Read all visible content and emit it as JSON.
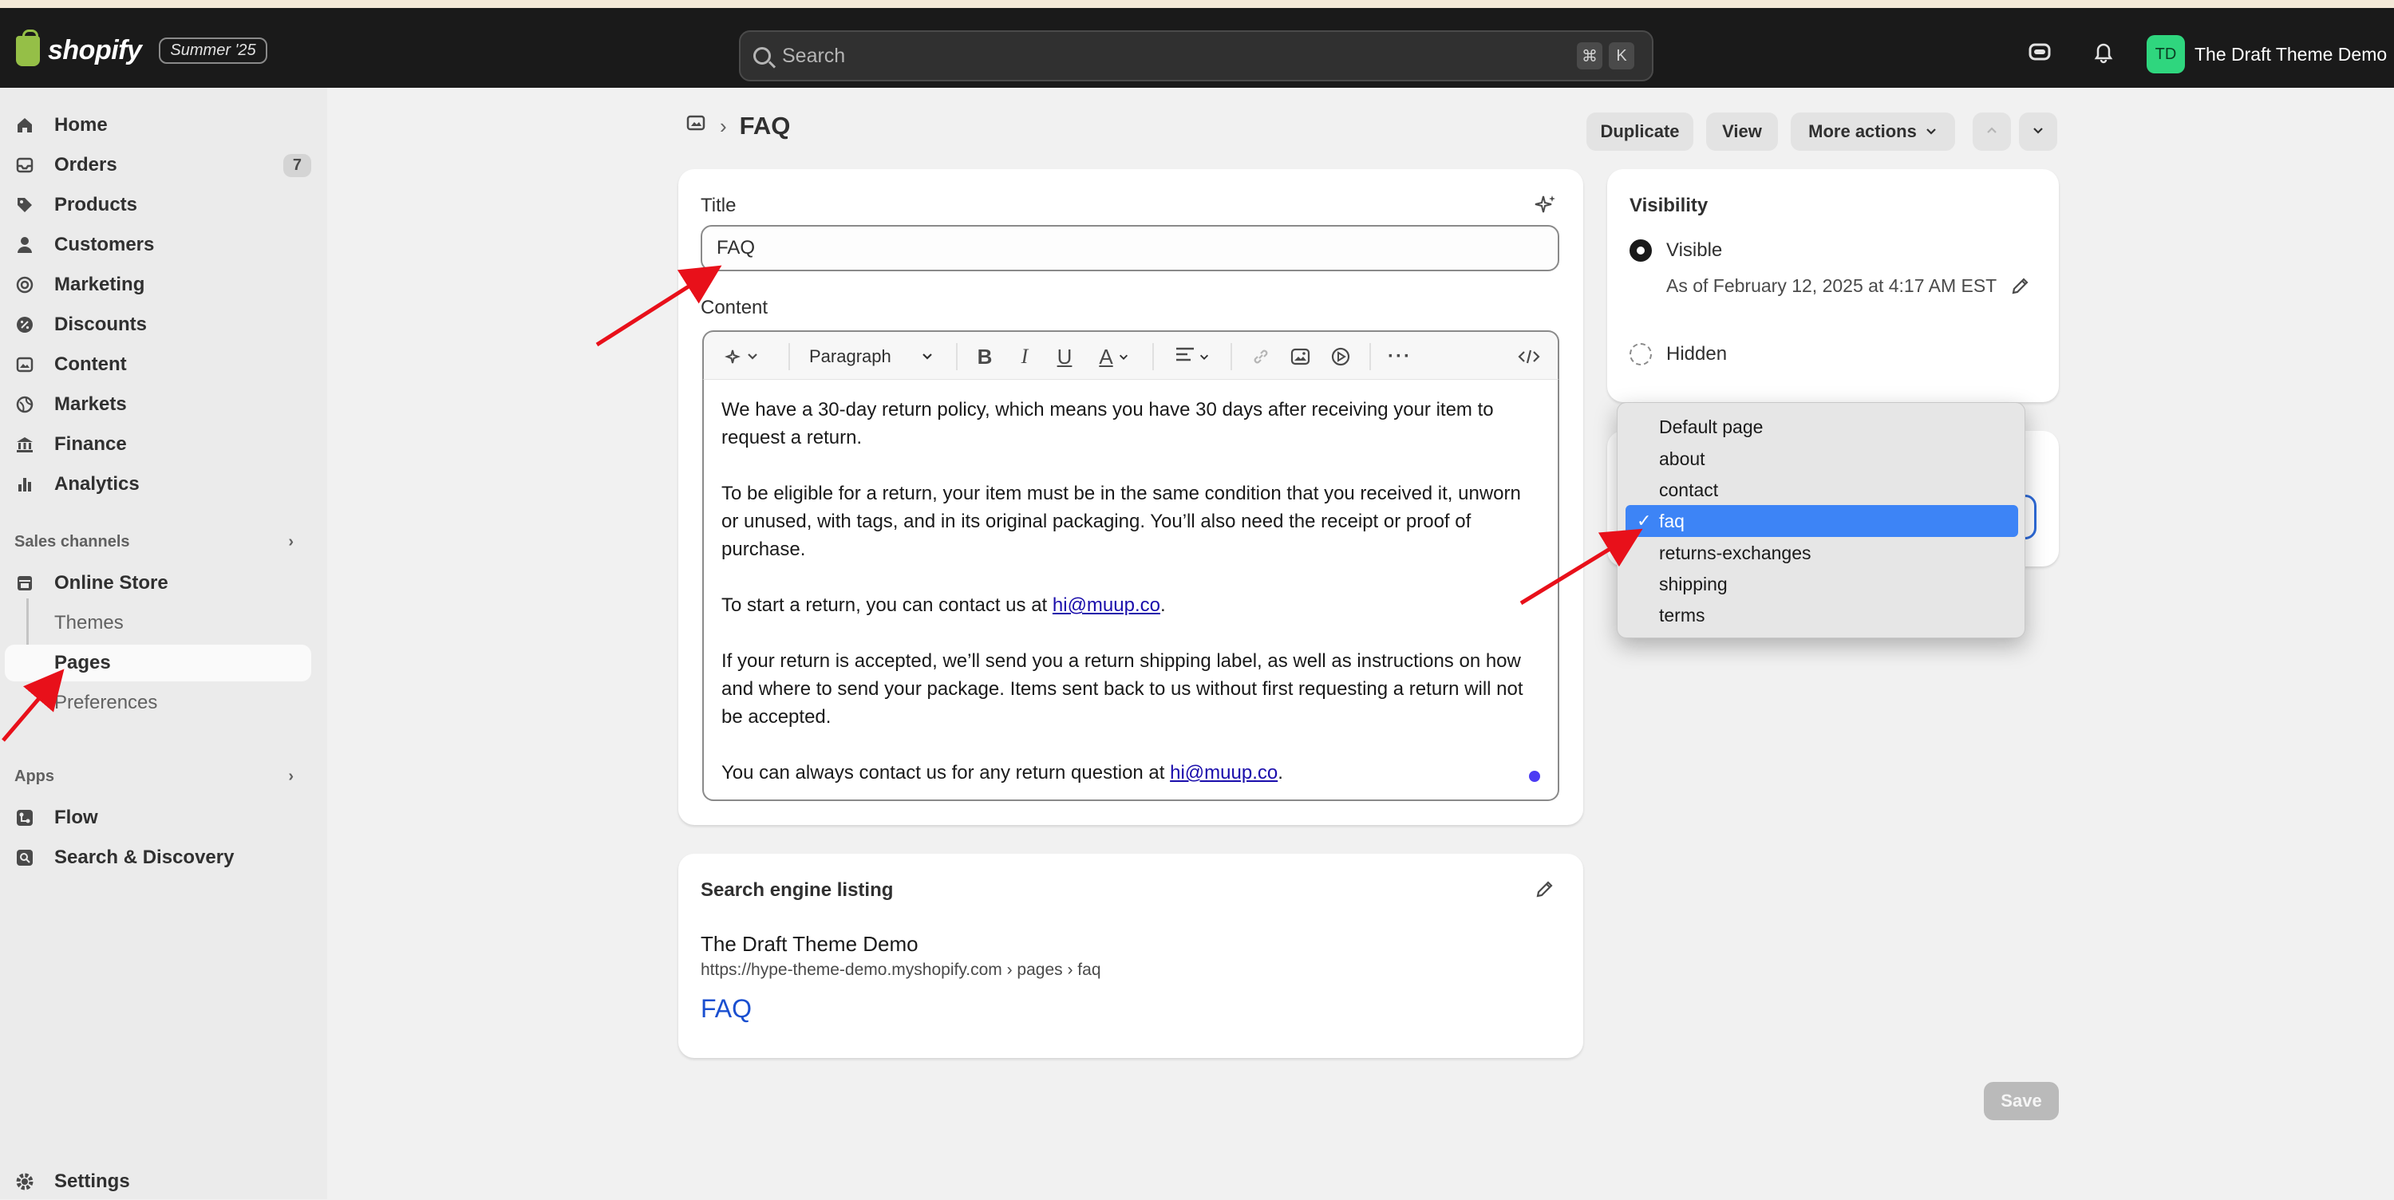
{
  "topbar": {
    "brand": "shopify",
    "edition": "Summer '25",
    "search_placeholder": "Search",
    "shortcut_keys": [
      "⌘",
      "K"
    ],
    "store_initials": "TD",
    "store_name": "The Draft Theme Demo"
  },
  "sidebar": {
    "items": [
      {
        "label": "Home",
        "icon": "home-icon"
      },
      {
        "label": "Orders",
        "icon": "inbox-icon",
        "badge": "7"
      },
      {
        "label": "Products",
        "icon": "tag-icon"
      },
      {
        "label": "Customers",
        "icon": "person-icon"
      },
      {
        "label": "Marketing",
        "icon": "target-icon"
      },
      {
        "label": "Discounts",
        "icon": "discount-icon"
      },
      {
        "label": "Content",
        "icon": "image-icon"
      },
      {
        "label": "Markets",
        "icon": "globe-icon"
      },
      {
        "label": "Finance",
        "icon": "bank-icon"
      },
      {
        "label": "Analytics",
        "icon": "bar-chart-icon"
      }
    ],
    "sales_channels_label": "Sales channels",
    "online_store": "Online Store",
    "sub_items": [
      "Themes",
      "Pages",
      "Preferences"
    ],
    "apps_label": "Apps",
    "apps": [
      {
        "label": "Flow",
        "icon": "flow-icon"
      },
      {
        "label": "Search & Discovery",
        "icon": "search-discovery-icon"
      }
    ],
    "settings": "Settings"
  },
  "header": {
    "title": "FAQ",
    "buttons": {
      "duplicate": "Duplicate",
      "view": "View",
      "more_actions": "More actions"
    }
  },
  "page_form": {
    "title_label": "Title",
    "title_value": "FAQ",
    "content_label": "Content",
    "paragraph_style": "Paragraph",
    "content": {
      "p1": "We have a 30-day return policy, which means you have 30 days after receiving your item to request a return.",
      "p2": "To be eligible for a return, your item must be in the same condition that you received it, unworn or unused, with tags, and in its original packaging. You’ll also need the receipt or proof of purchase.",
      "p3_prefix": "To start a return, you can contact us at ",
      "p3_link": "hi@muup.co",
      "p3_suffix": ".",
      "p4": "If your return is accepted, we’ll send you a return shipping label, as well as instructions on how and where to send your package. Items sent back to us without first requesting a return will not be accepted.",
      "p5_prefix": "You can always contact us for any return question at ",
      "p5_link": "hi@muup.co",
      "p5_suffix": "."
    }
  },
  "seo": {
    "heading": "Search engine listing",
    "site_name": "The Draft Theme Demo",
    "url": "https://hype-theme-demo.myshopify.com › pages › faq",
    "page_title": "FAQ"
  },
  "visibility": {
    "heading": "Visibility",
    "visible_label": "Visible",
    "visible_date": "As of February 12, 2025 at 4:17 AM EST",
    "hidden_label": "Hidden",
    "selected": "Visible"
  },
  "template_dropdown": {
    "options": [
      "Default page",
      "about",
      "contact",
      "faq",
      "returns-exchanges",
      "shipping",
      "terms"
    ],
    "selected": "faq",
    "check_mark": "✓"
  },
  "footer": {
    "save": "Save"
  },
  "colors": {
    "topbar": "#1a1a1a",
    "sidebar": "#ebebeb",
    "background": "#f1f1f1",
    "selection": "#3d84f6",
    "link": "#1a0dab",
    "annotation_arrow": "#e8101a"
  }
}
